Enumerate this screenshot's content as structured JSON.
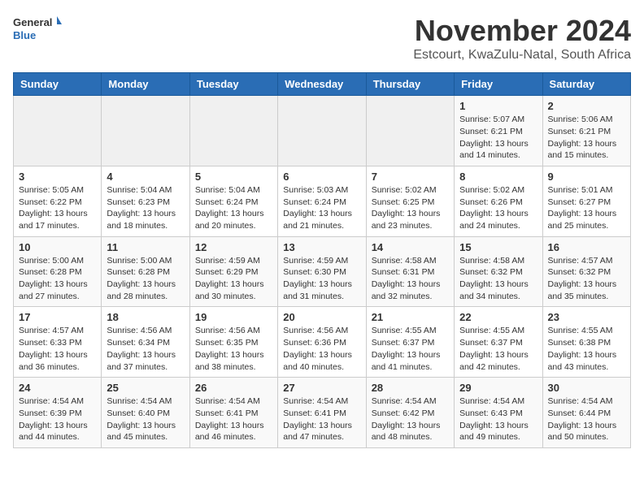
{
  "header": {
    "logo_general": "General",
    "logo_blue": "Blue",
    "month_title": "November 2024",
    "location": "Estcourt, KwaZulu-Natal, South Africa"
  },
  "days_of_week": [
    "Sunday",
    "Monday",
    "Tuesday",
    "Wednesday",
    "Thursday",
    "Friday",
    "Saturday"
  ],
  "weeks": [
    [
      {
        "day": "",
        "info": ""
      },
      {
        "day": "",
        "info": ""
      },
      {
        "day": "",
        "info": ""
      },
      {
        "day": "",
        "info": ""
      },
      {
        "day": "",
        "info": ""
      },
      {
        "day": "1",
        "info": "Sunrise: 5:07 AM\nSunset: 6:21 PM\nDaylight: 13 hours and 14 minutes."
      },
      {
        "day": "2",
        "info": "Sunrise: 5:06 AM\nSunset: 6:21 PM\nDaylight: 13 hours and 15 minutes."
      }
    ],
    [
      {
        "day": "3",
        "info": "Sunrise: 5:05 AM\nSunset: 6:22 PM\nDaylight: 13 hours and 17 minutes."
      },
      {
        "day": "4",
        "info": "Sunrise: 5:04 AM\nSunset: 6:23 PM\nDaylight: 13 hours and 18 minutes."
      },
      {
        "day": "5",
        "info": "Sunrise: 5:04 AM\nSunset: 6:24 PM\nDaylight: 13 hours and 20 minutes."
      },
      {
        "day": "6",
        "info": "Sunrise: 5:03 AM\nSunset: 6:24 PM\nDaylight: 13 hours and 21 minutes."
      },
      {
        "day": "7",
        "info": "Sunrise: 5:02 AM\nSunset: 6:25 PM\nDaylight: 13 hours and 23 minutes."
      },
      {
        "day": "8",
        "info": "Sunrise: 5:02 AM\nSunset: 6:26 PM\nDaylight: 13 hours and 24 minutes."
      },
      {
        "day": "9",
        "info": "Sunrise: 5:01 AM\nSunset: 6:27 PM\nDaylight: 13 hours and 25 minutes."
      }
    ],
    [
      {
        "day": "10",
        "info": "Sunrise: 5:00 AM\nSunset: 6:28 PM\nDaylight: 13 hours and 27 minutes."
      },
      {
        "day": "11",
        "info": "Sunrise: 5:00 AM\nSunset: 6:28 PM\nDaylight: 13 hours and 28 minutes."
      },
      {
        "day": "12",
        "info": "Sunrise: 4:59 AM\nSunset: 6:29 PM\nDaylight: 13 hours and 30 minutes."
      },
      {
        "day": "13",
        "info": "Sunrise: 4:59 AM\nSunset: 6:30 PM\nDaylight: 13 hours and 31 minutes."
      },
      {
        "day": "14",
        "info": "Sunrise: 4:58 AM\nSunset: 6:31 PM\nDaylight: 13 hours and 32 minutes."
      },
      {
        "day": "15",
        "info": "Sunrise: 4:58 AM\nSunset: 6:32 PM\nDaylight: 13 hours and 34 minutes."
      },
      {
        "day": "16",
        "info": "Sunrise: 4:57 AM\nSunset: 6:32 PM\nDaylight: 13 hours and 35 minutes."
      }
    ],
    [
      {
        "day": "17",
        "info": "Sunrise: 4:57 AM\nSunset: 6:33 PM\nDaylight: 13 hours and 36 minutes."
      },
      {
        "day": "18",
        "info": "Sunrise: 4:56 AM\nSunset: 6:34 PM\nDaylight: 13 hours and 37 minutes."
      },
      {
        "day": "19",
        "info": "Sunrise: 4:56 AM\nSunset: 6:35 PM\nDaylight: 13 hours and 38 minutes."
      },
      {
        "day": "20",
        "info": "Sunrise: 4:56 AM\nSunset: 6:36 PM\nDaylight: 13 hours and 40 minutes."
      },
      {
        "day": "21",
        "info": "Sunrise: 4:55 AM\nSunset: 6:37 PM\nDaylight: 13 hours and 41 minutes."
      },
      {
        "day": "22",
        "info": "Sunrise: 4:55 AM\nSunset: 6:37 PM\nDaylight: 13 hours and 42 minutes."
      },
      {
        "day": "23",
        "info": "Sunrise: 4:55 AM\nSunset: 6:38 PM\nDaylight: 13 hours and 43 minutes."
      }
    ],
    [
      {
        "day": "24",
        "info": "Sunrise: 4:54 AM\nSunset: 6:39 PM\nDaylight: 13 hours and 44 minutes."
      },
      {
        "day": "25",
        "info": "Sunrise: 4:54 AM\nSunset: 6:40 PM\nDaylight: 13 hours and 45 minutes."
      },
      {
        "day": "26",
        "info": "Sunrise: 4:54 AM\nSunset: 6:41 PM\nDaylight: 13 hours and 46 minutes."
      },
      {
        "day": "27",
        "info": "Sunrise: 4:54 AM\nSunset: 6:41 PM\nDaylight: 13 hours and 47 minutes."
      },
      {
        "day": "28",
        "info": "Sunrise: 4:54 AM\nSunset: 6:42 PM\nDaylight: 13 hours and 48 minutes."
      },
      {
        "day": "29",
        "info": "Sunrise: 4:54 AM\nSunset: 6:43 PM\nDaylight: 13 hours and 49 minutes."
      },
      {
        "day": "30",
        "info": "Sunrise: 4:54 AM\nSunset: 6:44 PM\nDaylight: 13 hours and 50 minutes."
      }
    ]
  ]
}
